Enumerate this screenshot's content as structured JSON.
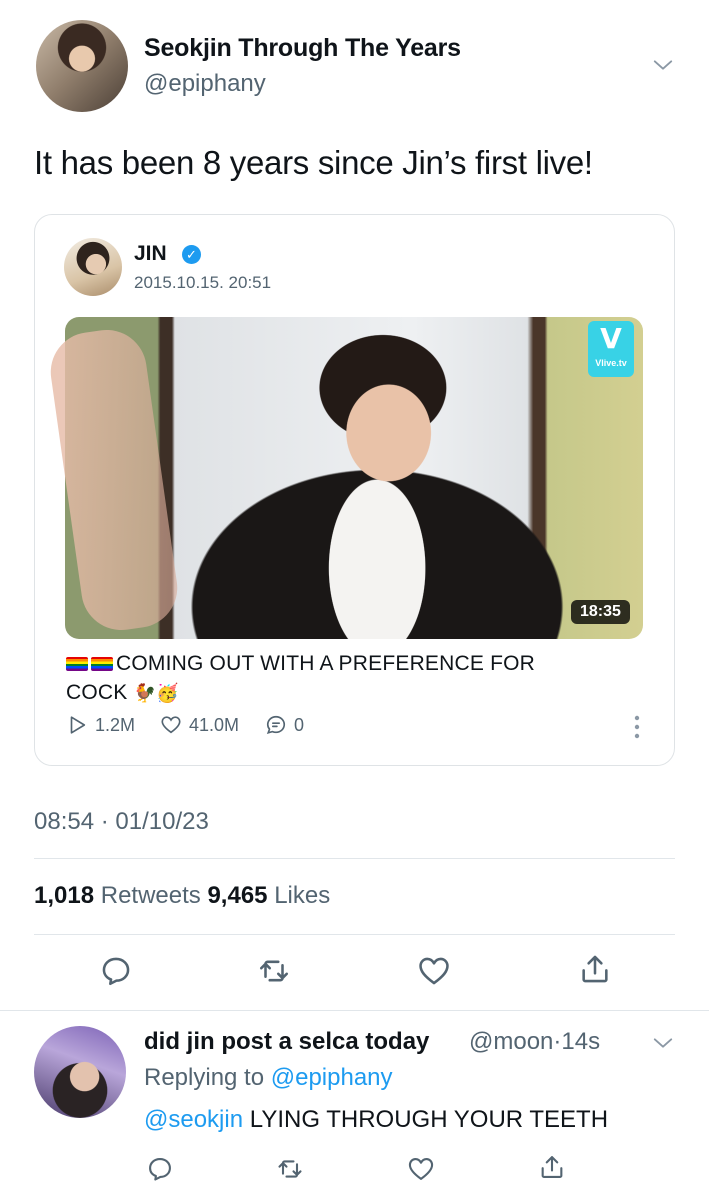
{
  "header": {
    "display_name": "Seokjin Through The Years",
    "handle": "@epiphany"
  },
  "tweet": {
    "text": "It has been 8 years since Jin’s first live!"
  },
  "quote": {
    "name": "JIN",
    "date": "2015.10.15. 20:51",
    "video": {
      "duration": "18:35",
      "logo_mark": "V",
      "logo_text": "Vlive.tv"
    },
    "caption_line1": "COMING OUT WITH A PREFERENCE FOR",
    "caption_line2": "COCK",
    "caption_emojis": "🐓🥳",
    "stats": {
      "plays": "1.2M",
      "likes": "41.0M",
      "comments": "0"
    }
  },
  "meta": {
    "time": "08:54",
    "date": "01/10/23",
    "retweets_count": "1,018",
    "retweets_label": "Retweets",
    "likes_count": "9,465",
    "likes_label": "Likes"
  },
  "reply": {
    "name": "did jin post a selca today",
    "handle": "@moon",
    "age": "14s",
    "replying_prefix": "Replying to",
    "replying_to": "@epiphany",
    "mention": "@seokjin",
    "text": "LYING THROUGH YOUR TEETH"
  },
  "colors": {
    "accent": "#1d9bf0",
    "secondary_text": "#536471",
    "divider": "#e1e6ea"
  },
  "icons": [
    "chevron-down-icon",
    "verified-badge-icon",
    "play-icon",
    "heart-icon",
    "comment-icon",
    "more-icon",
    "reply-icon",
    "retweet-icon",
    "like-icon",
    "share-icon"
  ]
}
